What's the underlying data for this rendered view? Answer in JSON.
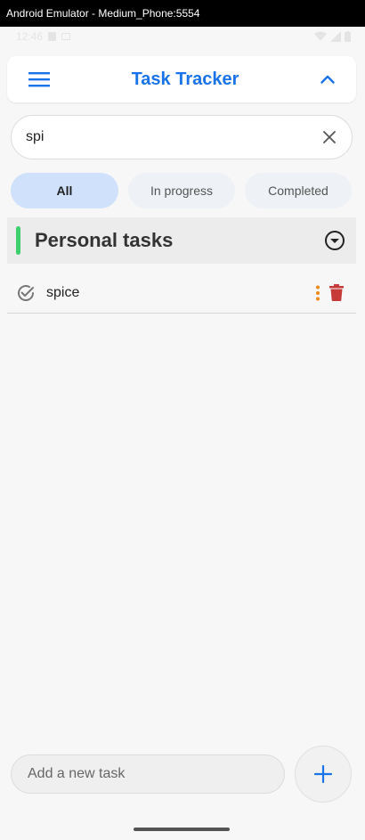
{
  "window": {
    "title": "Android Emulator - Medium_Phone:5554"
  },
  "status_bar": {
    "time": "12:46"
  },
  "app_bar": {
    "title": "Task Tracker",
    "menu_icon": "hamburger-menu-icon",
    "collapse_icon": "chevron-up-icon"
  },
  "search": {
    "value": "spi",
    "clear_icon": "close-icon"
  },
  "filters": [
    {
      "label": "All",
      "active": true
    },
    {
      "label": "In progress",
      "active": false
    },
    {
      "label": "Completed",
      "active": false
    }
  ],
  "group": {
    "title": "Personal tasks",
    "accent_color": "#3ecf6f",
    "toggle_icon": "dropdown-circle-icon"
  },
  "tasks": [
    {
      "text": "spice",
      "status_icon": "check-circle-icon",
      "options_icon": "more-vert-icon",
      "delete_icon": "trash-icon"
    }
  ],
  "new_task": {
    "placeholder": "Add a new task",
    "add_icon": "plus-icon"
  },
  "colors": {
    "accent": "#1a73e8",
    "active_chip": "#cfe1fb",
    "delete": "#c73a3a",
    "options": "#f08a1c"
  }
}
